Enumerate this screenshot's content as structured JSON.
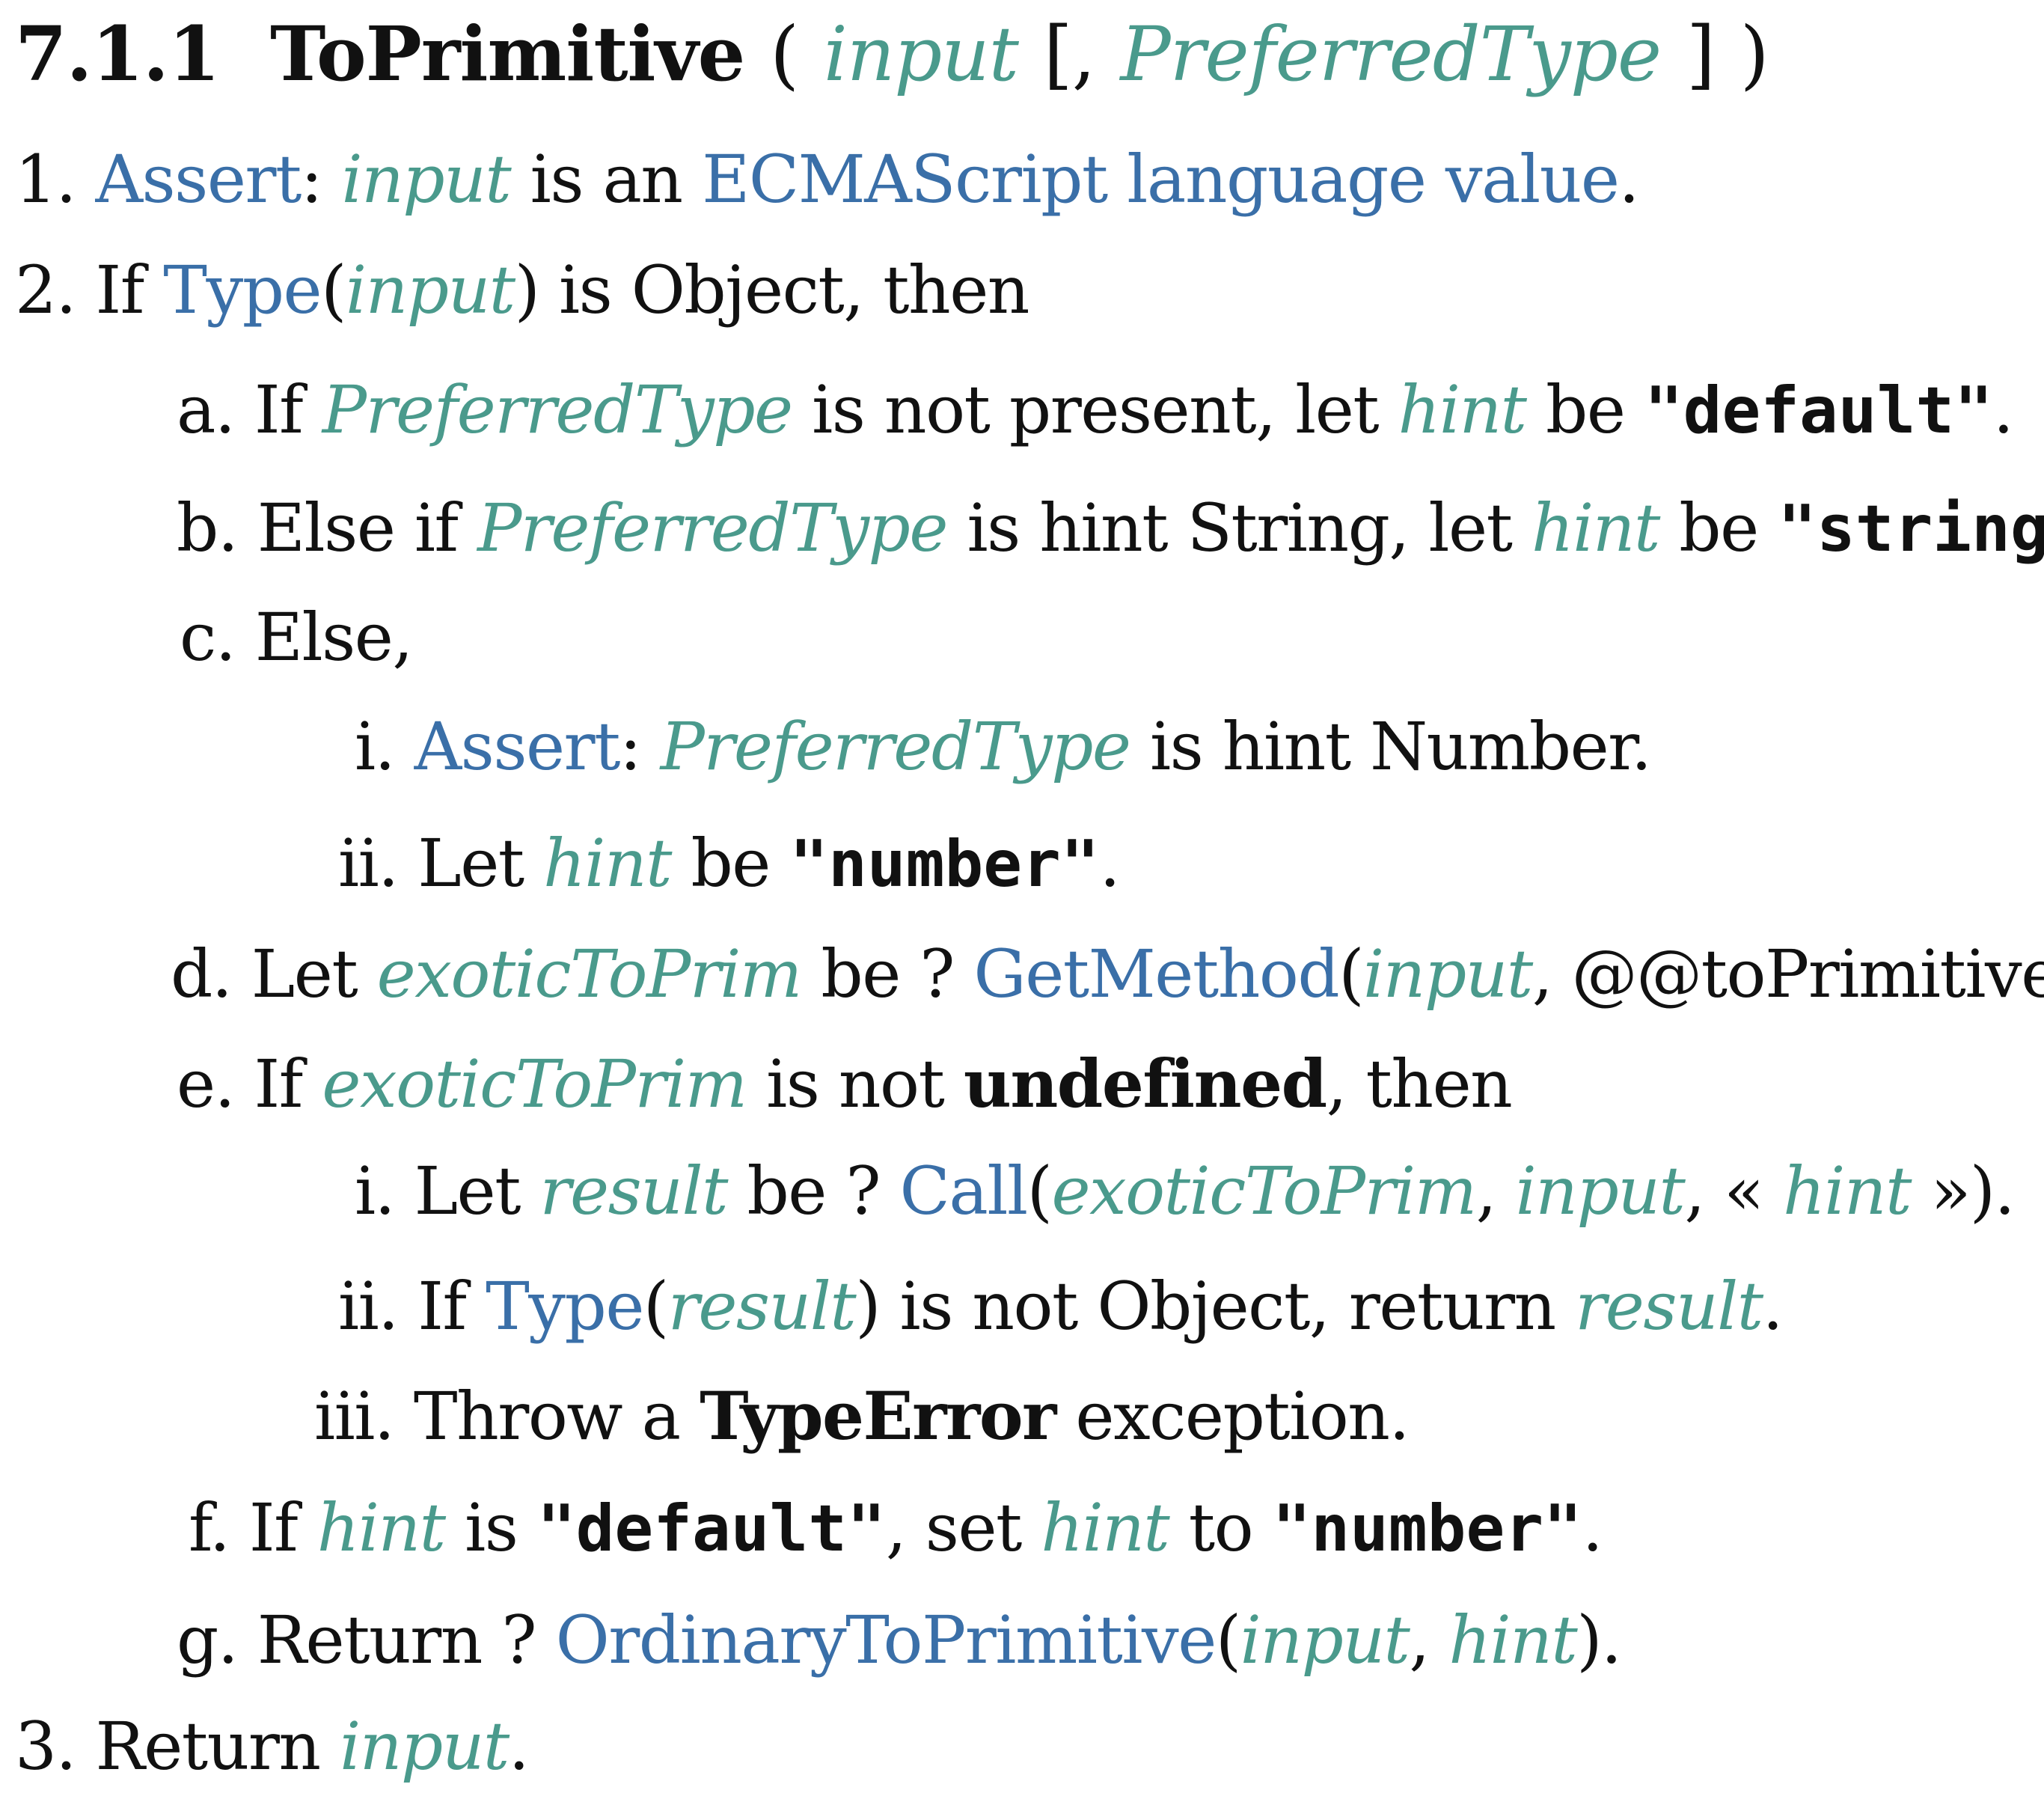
{
  "heading": {
    "number": "7.1.1",
    "name": "ToPrimitive",
    "open_paren": "(",
    "param_input": "input",
    "open_bracket": "[",
    "comma": ",",
    "param_preferred": "PreferredType",
    "close_bracket": "]",
    "close_paren": ")"
  },
  "steps": {
    "s1": {
      "num": "1.",
      "assert": "Assert",
      "colon": ":",
      "input": "input",
      "t1": "is an",
      "ecma": "ECMAScript language value",
      "end": "."
    },
    "s2": {
      "num": "2.",
      "t0": "If",
      "type": "Type",
      "p1": "(",
      "input": "input",
      "t1": ") is Object, then"
    },
    "s2a": {
      "num": "a.",
      "t0": "If",
      "pt": "PreferredType",
      "t1": "is not present, let",
      "hint": "hint",
      "t2": "be",
      "code": "\"default\"",
      "end": "."
    },
    "s2b": {
      "num": "b.",
      "t0": "Else if",
      "pt": "PreferredType",
      "t1": "is hint String, let",
      "hint": "hint",
      "t2": "be",
      "code": "\"string\"",
      "end": "."
    },
    "s2c": {
      "num": "c.",
      "t0": "Else,"
    },
    "s2ci": {
      "num": "i.",
      "assert": "Assert",
      "colon": ":",
      "pt": "PreferredType",
      "t1": "is hint Number."
    },
    "s2cii": {
      "num": "ii.",
      "t0": "Let",
      "hint": "hint",
      "t1": "be",
      "code": "\"number\"",
      "end": "."
    },
    "s2d": {
      "num": "d.",
      "t0": "Let",
      "etp": "exoticToPrim",
      "t1": "be ?",
      "gm": "GetMethod",
      "p1": "(",
      "input": "input",
      "t2": ", @@toPrimitive)."
    },
    "s2e": {
      "num": "e.",
      "t0": "If",
      "etp": "exoticToPrim",
      "t1": "is not",
      "undef": "undefined",
      "t2": ", then"
    },
    "s2ei": {
      "num": "i.",
      "t0": "Let",
      "result": "result",
      "t1": "be ?",
      "call": "Call",
      "p1": "(",
      "etp": "exoticToPrim",
      "c1": ",",
      "input": "input",
      "t2": ", «",
      "hint": "hint",
      "t3": "»)."
    },
    "s2eii": {
      "num": "ii.",
      "t0": "If",
      "type": "Type",
      "p1": "(",
      "result": "result",
      "t1": ") is not Object, return",
      "result2": "result",
      "end": "."
    },
    "s2eiii": {
      "num": "iii.",
      "t0": "Throw a",
      "te": "TypeError",
      "t1": "exception."
    },
    "s2f": {
      "num": "f.",
      "t0": "If",
      "hint": "hint",
      "t1": "is",
      "code1": "\"default\"",
      "t2": ", set",
      "hint2": "hint",
      "t3": "to",
      "code2": "\"number\"",
      "end": "."
    },
    "s2g": {
      "num": "g.",
      "t0": "Return ?",
      "otp": "OrdinaryToPrimitive",
      "p1": "(",
      "input": "input",
      "c1": ",",
      "hint": "hint",
      "t1": ")."
    },
    "s3": {
      "num": "3.",
      "t0": "Return",
      "input": "input",
      "end": "."
    }
  }
}
